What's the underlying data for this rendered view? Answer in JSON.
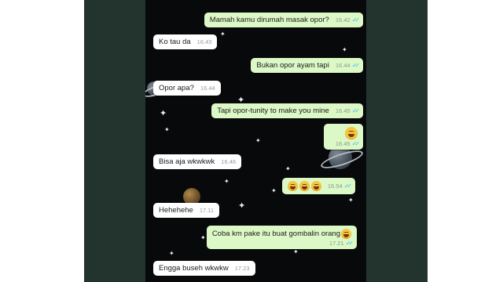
{
  "messages": [
    {
      "dir": "out",
      "text": "Mamah kamu dirumah masak opor?",
      "time": "16.42",
      "ticks": "✓✓"
    },
    {
      "dir": "in",
      "text": "Ko tau da",
      "time": "16.43"
    },
    {
      "dir": "out",
      "text": "Bukan opor ayam tapi",
      "time": "16.44",
      "ticks": "✓✓"
    },
    {
      "dir": "in",
      "text": "Opor apa?",
      "time": "16.44"
    },
    {
      "dir": "out",
      "text": "Tapi opor-tunity to make you mine",
      "time": "16.45",
      "ticks": "✓✓"
    },
    {
      "dir": "out",
      "text": "",
      "emoji": "tears-of-joy-emoji",
      "time": "16.45",
      "ticks": "✓✓"
    },
    {
      "dir": "in",
      "text": "Bisa aja wkwkwk",
      "time": "16.46"
    },
    {
      "dir": "out",
      "text": "",
      "emoji": "tears-of-joy-emoji x3",
      "time": "16.54",
      "ticks": "✓✓"
    },
    {
      "dir": "in",
      "text": "Hehehehe",
      "time": "17.11"
    },
    {
      "dir": "out",
      "text": "Coba km pake itu buat gombalin orang",
      "emoji": "tears-of-joy-emoji",
      "time": "17.21",
      "ticks": "✓✓"
    },
    {
      "dir": "in",
      "text": "Engga buseh wkwkw",
      "time": "17.23"
    }
  ],
  "colors": {
    "outgoing_bubble": "#dcf8c6",
    "incoming_bubble": "#ffffff",
    "chat_background": "#07090b",
    "read_tick": "#34b7f1"
  }
}
